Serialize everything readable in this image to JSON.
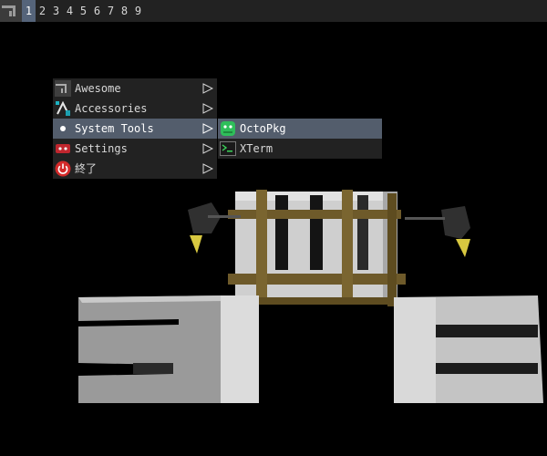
{
  "wibar": {
    "launcher_icon": "awesome-logo-icon",
    "tags": [
      "1",
      "2",
      "3",
      "4",
      "5",
      "6",
      "7",
      "8",
      "9"
    ],
    "active_tag": "1"
  },
  "main_menu": {
    "items": [
      {
        "label": "Awesome",
        "icon": "awesome-logo-icon",
        "has_submenu": true
      },
      {
        "label": "Accessories",
        "icon": "accessories-icon",
        "has_submenu": true
      },
      {
        "label": "System Tools",
        "icon": "dot-icon",
        "has_submenu": true,
        "active": true
      },
      {
        "label": "Settings",
        "icon": "settings-icon",
        "has_submenu": true
      },
      {
        "label": "終了",
        "icon": "power-icon",
        "has_submenu": true
      }
    ]
  },
  "submenu": {
    "items": [
      {
        "label": "OctoPkg",
        "icon": "octopkg-icon",
        "active": true
      },
      {
        "label": "XTerm",
        "icon": "terminal-icon"
      }
    ]
  },
  "colors": {
    "bar_bg": "#222222",
    "focus_bg": "#535d6c",
    "text": "#d8d8d8"
  }
}
